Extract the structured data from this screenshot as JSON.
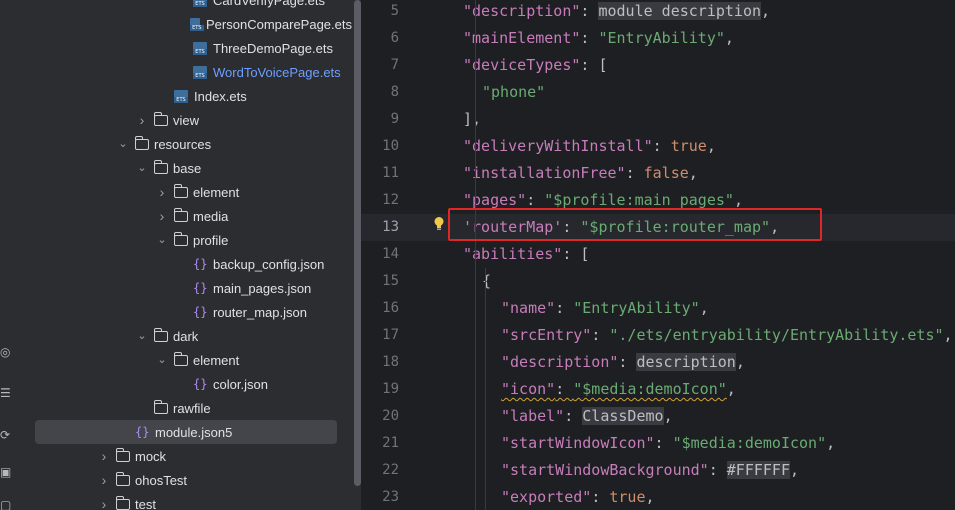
{
  "project_tree": {
    "rows": [
      {
        "label": "CardVerifyPage.ets",
        "indent": 6,
        "chevron": "",
        "icon": "ets",
        "blue": false
      },
      {
        "label": "PersonComparePage.ets",
        "indent": 6,
        "chevron": "",
        "icon": "ets",
        "blue": false
      },
      {
        "label": "ThreeDemoPage.ets",
        "indent": 6,
        "chevron": "",
        "icon": "ets",
        "blue": false
      },
      {
        "label": "WordToVoicePage.ets",
        "indent": 6,
        "chevron": "",
        "icon": "ets",
        "blue": true
      },
      {
        "label": "Index.ets",
        "indent": 5,
        "chevron": "",
        "icon": "ets",
        "blue": false
      },
      {
        "label": "view",
        "indent": 4,
        "chevron": "right",
        "icon": "folder",
        "blue": false
      },
      {
        "label": "resources",
        "indent": 3,
        "chevron": "down",
        "icon": "folder",
        "blue": false
      },
      {
        "label": "base",
        "indent": 4,
        "chevron": "down",
        "icon": "folder",
        "blue": false
      },
      {
        "label": "element",
        "indent": 5,
        "chevron": "right",
        "icon": "folder",
        "blue": false
      },
      {
        "label": "media",
        "indent": 5,
        "chevron": "right",
        "icon": "folder",
        "blue": false
      },
      {
        "label": "profile",
        "indent": 5,
        "chevron": "down",
        "icon": "folder",
        "blue": false
      },
      {
        "label": "backup_config.json",
        "indent": 6,
        "chevron": "",
        "icon": "json",
        "blue": false
      },
      {
        "label": "main_pages.json",
        "indent": 6,
        "chevron": "",
        "icon": "json",
        "blue": false
      },
      {
        "label": "router_map.json",
        "indent": 6,
        "chevron": "",
        "icon": "json",
        "blue": false
      },
      {
        "label": "dark",
        "indent": 4,
        "chevron": "down",
        "icon": "folder",
        "blue": false
      },
      {
        "label": "element",
        "indent": 5,
        "chevron": "down",
        "icon": "folder",
        "blue": false
      },
      {
        "label": "color.json",
        "indent": 6,
        "chevron": "",
        "icon": "json",
        "blue": false
      },
      {
        "label": "rawfile",
        "indent": 4,
        "chevron": "",
        "icon": "folder",
        "blue": false
      },
      {
        "label": "module.json5",
        "indent": 3,
        "chevron": "",
        "icon": "json",
        "blue": false,
        "selected": true
      },
      {
        "label": "mock",
        "indent": 2,
        "chevron": "right",
        "icon": "folder",
        "blue": false
      },
      {
        "label": "ohosTest",
        "indent": 2,
        "chevron": "right",
        "icon": "folder",
        "blue": false
      },
      {
        "label": "test",
        "indent": 2,
        "chevron": "right",
        "icon": "folder",
        "blue": false
      }
    ]
  },
  "editor": {
    "current_line": 13,
    "lines": [
      {
        "num": "5",
        "indent": 2,
        "tokens": [
          [
            "k",
            "\"description\""
          ],
          [
            "p",
            ": "
          ],
          [
            "u",
            "module description"
          ],
          [
            "p",
            ","
          ]
        ]
      },
      {
        "num": "6",
        "indent": 2,
        "tokens": [
          [
            "k",
            "\"mainElement\""
          ],
          [
            "p",
            ": "
          ],
          [
            "s",
            "\"EntryAbility\""
          ],
          [
            "p",
            ","
          ]
        ]
      },
      {
        "num": "7",
        "indent": 2,
        "tokens": [
          [
            "k",
            "\"deviceTypes\""
          ],
          [
            "p",
            ": ["
          ]
        ]
      },
      {
        "num": "8",
        "indent": 3,
        "tokens": [
          [
            "s",
            "\"phone\""
          ]
        ]
      },
      {
        "num": "9",
        "indent": 2,
        "tokens": [
          [
            "p",
            "],"
          ]
        ]
      },
      {
        "num": "10",
        "indent": 2,
        "tokens": [
          [
            "k",
            "\"deliveryWithInstall\""
          ],
          [
            "p",
            ": "
          ],
          [
            "b",
            "true"
          ],
          [
            "p",
            ","
          ]
        ]
      },
      {
        "num": "11",
        "indent": 2,
        "tokens": [
          [
            "k",
            "\"installationFree\""
          ],
          [
            "p",
            ": "
          ],
          [
            "b",
            "false"
          ],
          [
            "p",
            ","
          ]
        ]
      },
      {
        "num": "12",
        "indent": 2,
        "tokens": [
          [
            "k",
            "\"pages\""
          ],
          [
            "p",
            ": "
          ],
          [
            "s",
            "\"$profile:main_pages\""
          ],
          [
            "p",
            ","
          ]
        ]
      },
      {
        "num": "13",
        "indent": 2,
        "tokens": [
          [
            "k",
            "'routerMap'"
          ],
          [
            "p",
            ": "
          ],
          [
            "s",
            "\"$profile:router_map\""
          ],
          [
            "p",
            ","
          ]
        ]
      },
      {
        "num": "14",
        "indent": 2,
        "tokens": [
          [
            "k",
            "\"abilities\""
          ],
          [
            "p",
            ": ["
          ]
        ]
      },
      {
        "num": "15",
        "indent": 3,
        "tokens": [
          [
            "p",
            "{"
          ]
        ]
      },
      {
        "num": "16",
        "indent": 4,
        "tokens": [
          [
            "k",
            "\"name\""
          ],
          [
            "p",
            ": "
          ],
          [
            "s",
            "\"EntryAbility\""
          ],
          [
            "p",
            ","
          ]
        ]
      },
      {
        "num": "17",
        "indent": 4,
        "tokens": [
          [
            "k",
            "\"srcEntry\""
          ],
          [
            "p",
            ": "
          ],
          [
            "s",
            "\"./ets/entryability/EntryAbility.ets\""
          ],
          [
            "p",
            ","
          ]
        ]
      },
      {
        "num": "18",
        "indent": 4,
        "tokens": [
          [
            "k",
            "\"description\""
          ],
          [
            "p",
            ": "
          ],
          [
            "u",
            "description"
          ],
          [
            "p",
            ","
          ]
        ]
      },
      {
        "num": "19",
        "indent": 4,
        "tokens": [
          [
            "kw",
            "\"icon\""
          ],
          [
            "pw",
            ": "
          ],
          [
            "sw",
            "\"$media:demoIcon\""
          ],
          [
            "p",
            ","
          ]
        ]
      },
      {
        "num": "20",
        "indent": 4,
        "tokens": [
          [
            "k",
            "\"label\""
          ],
          [
            "p",
            ": "
          ],
          [
            "u",
            "ClassDemo"
          ],
          [
            "p",
            ","
          ]
        ]
      },
      {
        "num": "21",
        "indent": 4,
        "tokens": [
          [
            "k",
            "\"startWindowIcon\""
          ],
          [
            "p",
            ": "
          ],
          [
            "s",
            "\"$media:demoIcon\""
          ],
          [
            "p",
            ","
          ]
        ]
      },
      {
        "num": "22",
        "indent": 4,
        "tokens": [
          [
            "k",
            "\"startWindowBackground\""
          ],
          [
            "p",
            ": "
          ],
          [
            "u",
            "#FFFFFF"
          ],
          [
            "p",
            ","
          ]
        ]
      },
      {
        "num": "23",
        "indent": 4,
        "tokens": [
          [
            "k",
            "\"exported\""
          ],
          [
            "p",
            ": "
          ],
          [
            "b",
            "true"
          ],
          [
            "p",
            ","
          ]
        ]
      }
    ]
  },
  "activity_bar": {
    "icons": [
      "structure-icon",
      "database-icon",
      "sync-icon",
      "terminal-icon",
      "notifications-icon"
    ]
  },
  "colors": {
    "highlight_box": "#e02727",
    "selected_file": "#6f9fff"
  }
}
